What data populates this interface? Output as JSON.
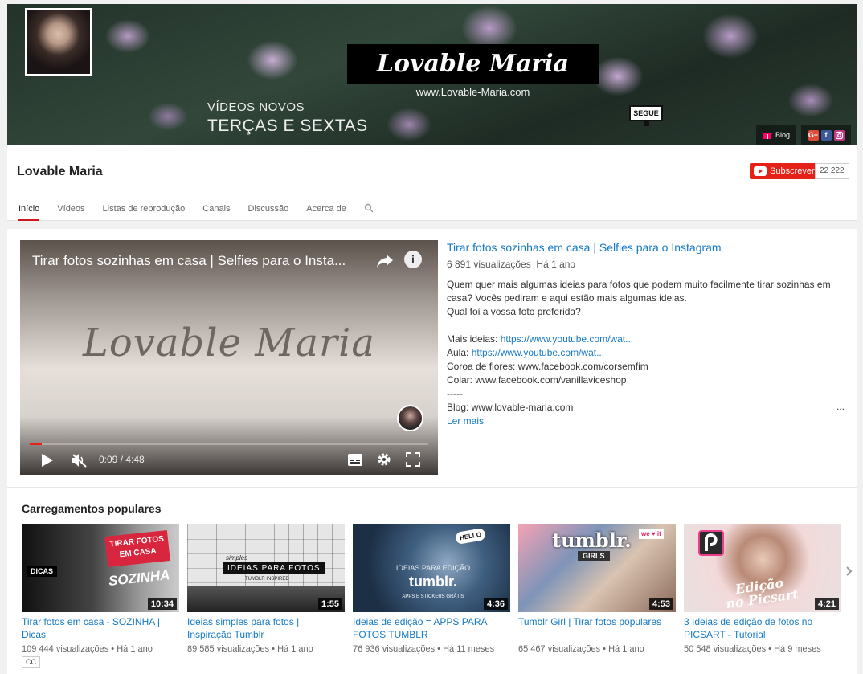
{
  "banner": {
    "logo_text": "Lovable Maria",
    "url_text": "www.Lovable-Maria.com",
    "line1": "VÍDEOS NOVOS",
    "line2": "TERÇAS E SEXTAS",
    "sticker": "SEGUE",
    "blog_label": "Blog",
    "social_gplus": "G+",
    "social_fb": "f"
  },
  "channel": {
    "name": "Lovable Maria",
    "subscribe_label": "Subscrever",
    "subscriber_count": "22 222"
  },
  "tabs": [
    "Início",
    "Vídeos",
    "Listas de reprodução",
    "Canais",
    "Discussão",
    "Acerca de"
  ],
  "featured": {
    "player_title": "Tirar fotos sozinhas em casa | Selfies para o Insta...",
    "watermark": "Lovable Maria",
    "time": "0:09 / 4:48",
    "progress": 0.031,
    "title": "Tirar fotos sozinhas em casa | Selfies para o Instagram",
    "views": "6 891 visualizações",
    "age": "Há 1 ano",
    "desc_line1": "Quem quer mais algumas ideias para fotos que podem muito facilmente tirar sozinhas em casa? Vocês pediram e aqui estão mais algumas ideias.",
    "desc_line2": "Qual foi a vossa foto preferida?",
    "more_label": "Mais ideias: ",
    "more_link": "https://www.youtube.com/wat...",
    "aula_label": "Aula: ",
    "aula_link": "https://www.youtube.com/wat...",
    "coroa": "Coroa de flores: www.facebook.com/corsemfim",
    "colar": "Colar: www.facebook.com/vanillaviceshop",
    "dashes": "-----",
    "blog": "Blog: www.lovable-maria.com",
    "ellipsis": "...",
    "read_more": "Ler mais"
  },
  "popular": {
    "title": "Carregamentos populares",
    "items": [
      {
        "title": "Tirar fotos em casa - SOZINHA | Dicas",
        "views": "109 444 visualizações",
        "age": "Há 1 ano",
        "duration": "10:34",
        "cc": "CC",
        "t1": "TIRAR FOTOS EM CASA",
        "t2": "SOZINHA",
        "t3": "DICAS"
      },
      {
        "title": "Ideias simples para fotos | Inspiração Tumblr",
        "views": "89 585 visualizações",
        "age": "Há 1 ano",
        "duration": "1:55",
        "t1": "simples",
        "t2": "IDEIAS PARA FOTOS",
        "t3": "TUMBLR INSPIRED"
      },
      {
        "title": "Ideias de edição = APPS PARA FOTOS TUMBLR",
        "views": "76 936 visualizações",
        "age": "Há 11 meses",
        "duration": "4:36",
        "t1": "IDEIAS PARA EDIÇÃO",
        "t2": "tumblr.",
        "t3": "APPS E STICKERS GRÁTIS",
        "t4": "HELLO"
      },
      {
        "title": "Tumblr Girl | Tirar fotos populares",
        "views": "65 467 visualizações",
        "age": "Há 1 ano",
        "duration": "4:53",
        "t1": "tumblr.",
        "t2": "GIRLS",
        "t3": "we ♥ it"
      },
      {
        "title": "3 Ideias de edição de fotos no PICSART - Tutorial",
        "views": "50 548 visualizações",
        "age": "Há 9 meses",
        "duration": "4:21",
        "t1": "Edição",
        "t2": "no Picsart"
      }
    ]
  },
  "colors": {
    "accent": "#cc181e",
    "subscribe": "#e62117",
    "link": "#167ac6"
  }
}
